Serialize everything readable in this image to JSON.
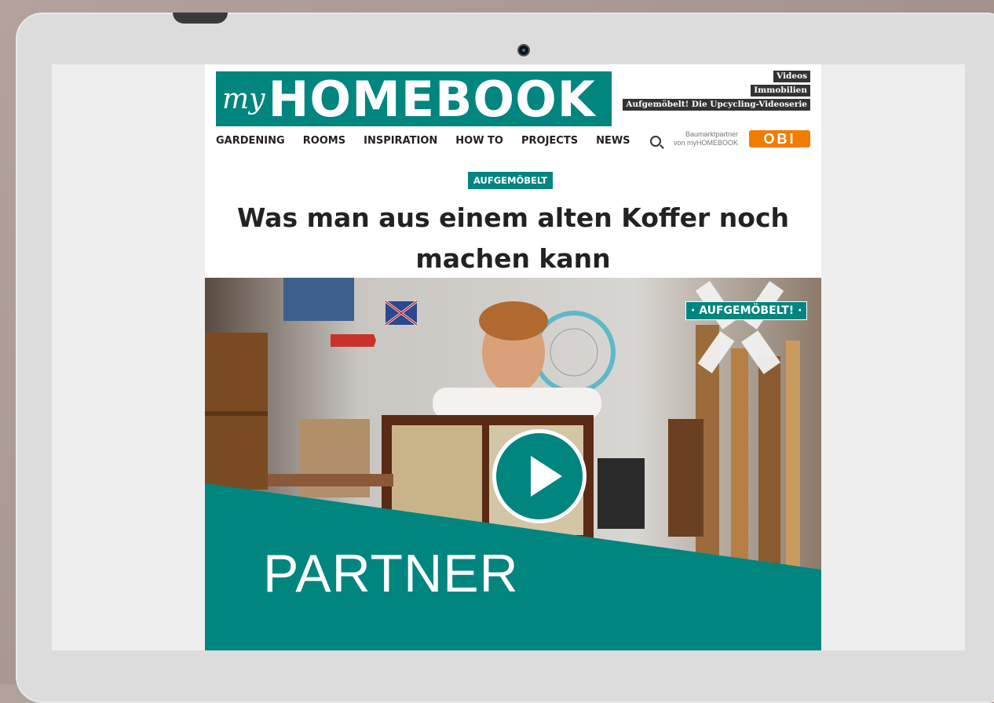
{
  "site": {
    "logo_my": "my",
    "logo_home": "HOMEBOOK",
    "toplinks": [
      "Videos",
      "Immobilien",
      "Aufgemöbelt! Die Upcycling-Videoserie"
    ],
    "nav": [
      "GARDENING",
      "ROOMS",
      "INSPIRATION",
      "HOW TO",
      "PROJECTS",
      "NEWS"
    ],
    "partner_note_line1": "Baumarktpartner",
    "partner_note_line2": "von myHOMEBOOK",
    "obi_logo": "OBI"
  },
  "article": {
    "tag": "AUFGEMÖBELT",
    "headline_line1": "Was man aus einem alten Koffer noch",
    "headline_line2": "machen kann"
  },
  "video": {
    "badge": "· AUFGEMÖBELT! ·",
    "overlay_text": "PARTNER"
  },
  "colors": {
    "brand": "#00857f",
    "obi": "#f07d00"
  }
}
